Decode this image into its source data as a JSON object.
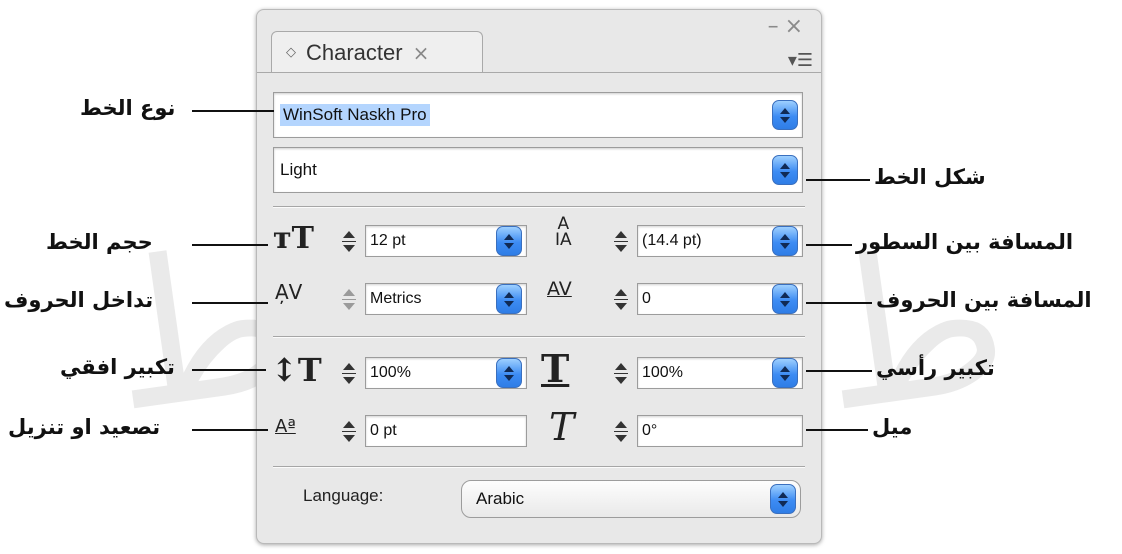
{
  "panel": {
    "tab_label": "Character",
    "font_family": "WinSoft Naskh Pro",
    "font_style": "Light",
    "font_size": "12 pt",
    "leading": "(14.4 pt)",
    "kerning": "Metrics",
    "tracking": "0",
    "vertical_scale": "100%",
    "horizontal_scale": "100%",
    "baseline_shift": "0 pt",
    "skew": "0°",
    "language_label": "Language:",
    "language": "Arabic"
  },
  "icons": {
    "panel_options": "panel-menu-icon",
    "minimize": "minimize-icon",
    "close": "close-icon"
  },
  "callouts": {
    "font_type": "نوع الخط",
    "font_shape": "شكل الخط",
    "font_size": "حجم الخط",
    "line_spacing": "المسافة بين السطور",
    "letter_overlap": "تداخل الحروف",
    "letter_spacing": "المسافة بين الحروف",
    "horizontal_enlarge": "تكبير افقي",
    "vertical_enlarge": "تكبير رأسي",
    "raise_lower": "تصعيد او تنزيل",
    "slant": "ميل"
  },
  "watermark": {
    "glyph": "ط"
  },
  "colors": {
    "accent": "#3d8cf3",
    "selection": "#b4d5fe"
  }
}
